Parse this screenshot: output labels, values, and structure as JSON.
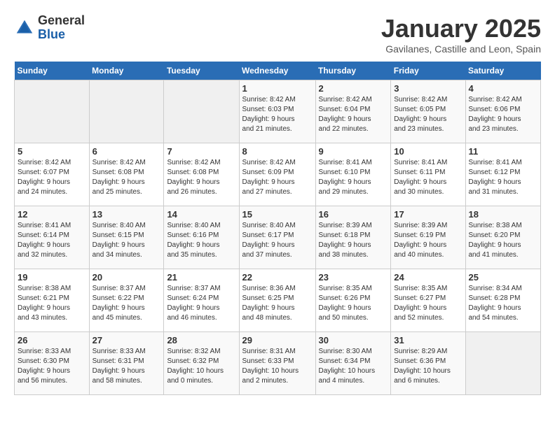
{
  "header": {
    "logo_general": "General",
    "logo_blue": "Blue",
    "month_title": "January 2025",
    "subtitle": "Gavilanes, Castille and Leon, Spain"
  },
  "days_of_week": [
    "Sunday",
    "Monday",
    "Tuesday",
    "Wednesday",
    "Thursday",
    "Friday",
    "Saturday"
  ],
  "weeks": [
    [
      {
        "day": "",
        "detail": ""
      },
      {
        "day": "",
        "detail": ""
      },
      {
        "day": "",
        "detail": ""
      },
      {
        "day": "1",
        "detail": "Sunrise: 8:42 AM\nSunset: 6:03 PM\nDaylight: 9 hours\nand 21 minutes."
      },
      {
        "day": "2",
        "detail": "Sunrise: 8:42 AM\nSunset: 6:04 PM\nDaylight: 9 hours\nand 22 minutes."
      },
      {
        "day": "3",
        "detail": "Sunrise: 8:42 AM\nSunset: 6:05 PM\nDaylight: 9 hours\nand 23 minutes."
      },
      {
        "day": "4",
        "detail": "Sunrise: 8:42 AM\nSunset: 6:06 PM\nDaylight: 9 hours\nand 23 minutes."
      }
    ],
    [
      {
        "day": "5",
        "detail": "Sunrise: 8:42 AM\nSunset: 6:07 PM\nDaylight: 9 hours\nand 24 minutes."
      },
      {
        "day": "6",
        "detail": "Sunrise: 8:42 AM\nSunset: 6:08 PM\nDaylight: 9 hours\nand 25 minutes."
      },
      {
        "day": "7",
        "detail": "Sunrise: 8:42 AM\nSunset: 6:08 PM\nDaylight: 9 hours\nand 26 minutes."
      },
      {
        "day": "8",
        "detail": "Sunrise: 8:42 AM\nSunset: 6:09 PM\nDaylight: 9 hours\nand 27 minutes."
      },
      {
        "day": "9",
        "detail": "Sunrise: 8:41 AM\nSunset: 6:10 PM\nDaylight: 9 hours\nand 29 minutes."
      },
      {
        "day": "10",
        "detail": "Sunrise: 8:41 AM\nSunset: 6:11 PM\nDaylight: 9 hours\nand 30 minutes."
      },
      {
        "day": "11",
        "detail": "Sunrise: 8:41 AM\nSunset: 6:12 PM\nDaylight: 9 hours\nand 31 minutes."
      }
    ],
    [
      {
        "day": "12",
        "detail": "Sunrise: 8:41 AM\nSunset: 6:14 PM\nDaylight: 9 hours\nand 32 minutes."
      },
      {
        "day": "13",
        "detail": "Sunrise: 8:40 AM\nSunset: 6:15 PM\nDaylight: 9 hours\nand 34 minutes."
      },
      {
        "day": "14",
        "detail": "Sunrise: 8:40 AM\nSunset: 6:16 PM\nDaylight: 9 hours\nand 35 minutes."
      },
      {
        "day": "15",
        "detail": "Sunrise: 8:40 AM\nSunset: 6:17 PM\nDaylight: 9 hours\nand 37 minutes."
      },
      {
        "day": "16",
        "detail": "Sunrise: 8:39 AM\nSunset: 6:18 PM\nDaylight: 9 hours\nand 38 minutes."
      },
      {
        "day": "17",
        "detail": "Sunrise: 8:39 AM\nSunset: 6:19 PM\nDaylight: 9 hours\nand 40 minutes."
      },
      {
        "day": "18",
        "detail": "Sunrise: 8:38 AM\nSunset: 6:20 PM\nDaylight: 9 hours\nand 41 minutes."
      }
    ],
    [
      {
        "day": "19",
        "detail": "Sunrise: 8:38 AM\nSunset: 6:21 PM\nDaylight: 9 hours\nand 43 minutes."
      },
      {
        "day": "20",
        "detail": "Sunrise: 8:37 AM\nSunset: 6:22 PM\nDaylight: 9 hours\nand 45 minutes."
      },
      {
        "day": "21",
        "detail": "Sunrise: 8:37 AM\nSunset: 6:24 PM\nDaylight: 9 hours\nand 46 minutes."
      },
      {
        "day": "22",
        "detail": "Sunrise: 8:36 AM\nSunset: 6:25 PM\nDaylight: 9 hours\nand 48 minutes."
      },
      {
        "day": "23",
        "detail": "Sunrise: 8:35 AM\nSunset: 6:26 PM\nDaylight: 9 hours\nand 50 minutes."
      },
      {
        "day": "24",
        "detail": "Sunrise: 8:35 AM\nSunset: 6:27 PM\nDaylight: 9 hours\nand 52 minutes."
      },
      {
        "day": "25",
        "detail": "Sunrise: 8:34 AM\nSunset: 6:28 PM\nDaylight: 9 hours\nand 54 minutes."
      }
    ],
    [
      {
        "day": "26",
        "detail": "Sunrise: 8:33 AM\nSunset: 6:30 PM\nDaylight: 9 hours\nand 56 minutes."
      },
      {
        "day": "27",
        "detail": "Sunrise: 8:33 AM\nSunset: 6:31 PM\nDaylight: 9 hours\nand 58 minutes."
      },
      {
        "day": "28",
        "detail": "Sunrise: 8:32 AM\nSunset: 6:32 PM\nDaylight: 10 hours\nand 0 minutes."
      },
      {
        "day": "29",
        "detail": "Sunrise: 8:31 AM\nSunset: 6:33 PM\nDaylight: 10 hours\nand 2 minutes."
      },
      {
        "day": "30",
        "detail": "Sunrise: 8:30 AM\nSunset: 6:34 PM\nDaylight: 10 hours\nand 4 minutes."
      },
      {
        "day": "31",
        "detail": "Sunrise: 8:29 AM\nSunset: 6:36 PM\nDaylight: 10 hours\nand 6 minutes."
      },
      {
        "day": "",
        "detail": ""
      }
    ]
  ]
}
